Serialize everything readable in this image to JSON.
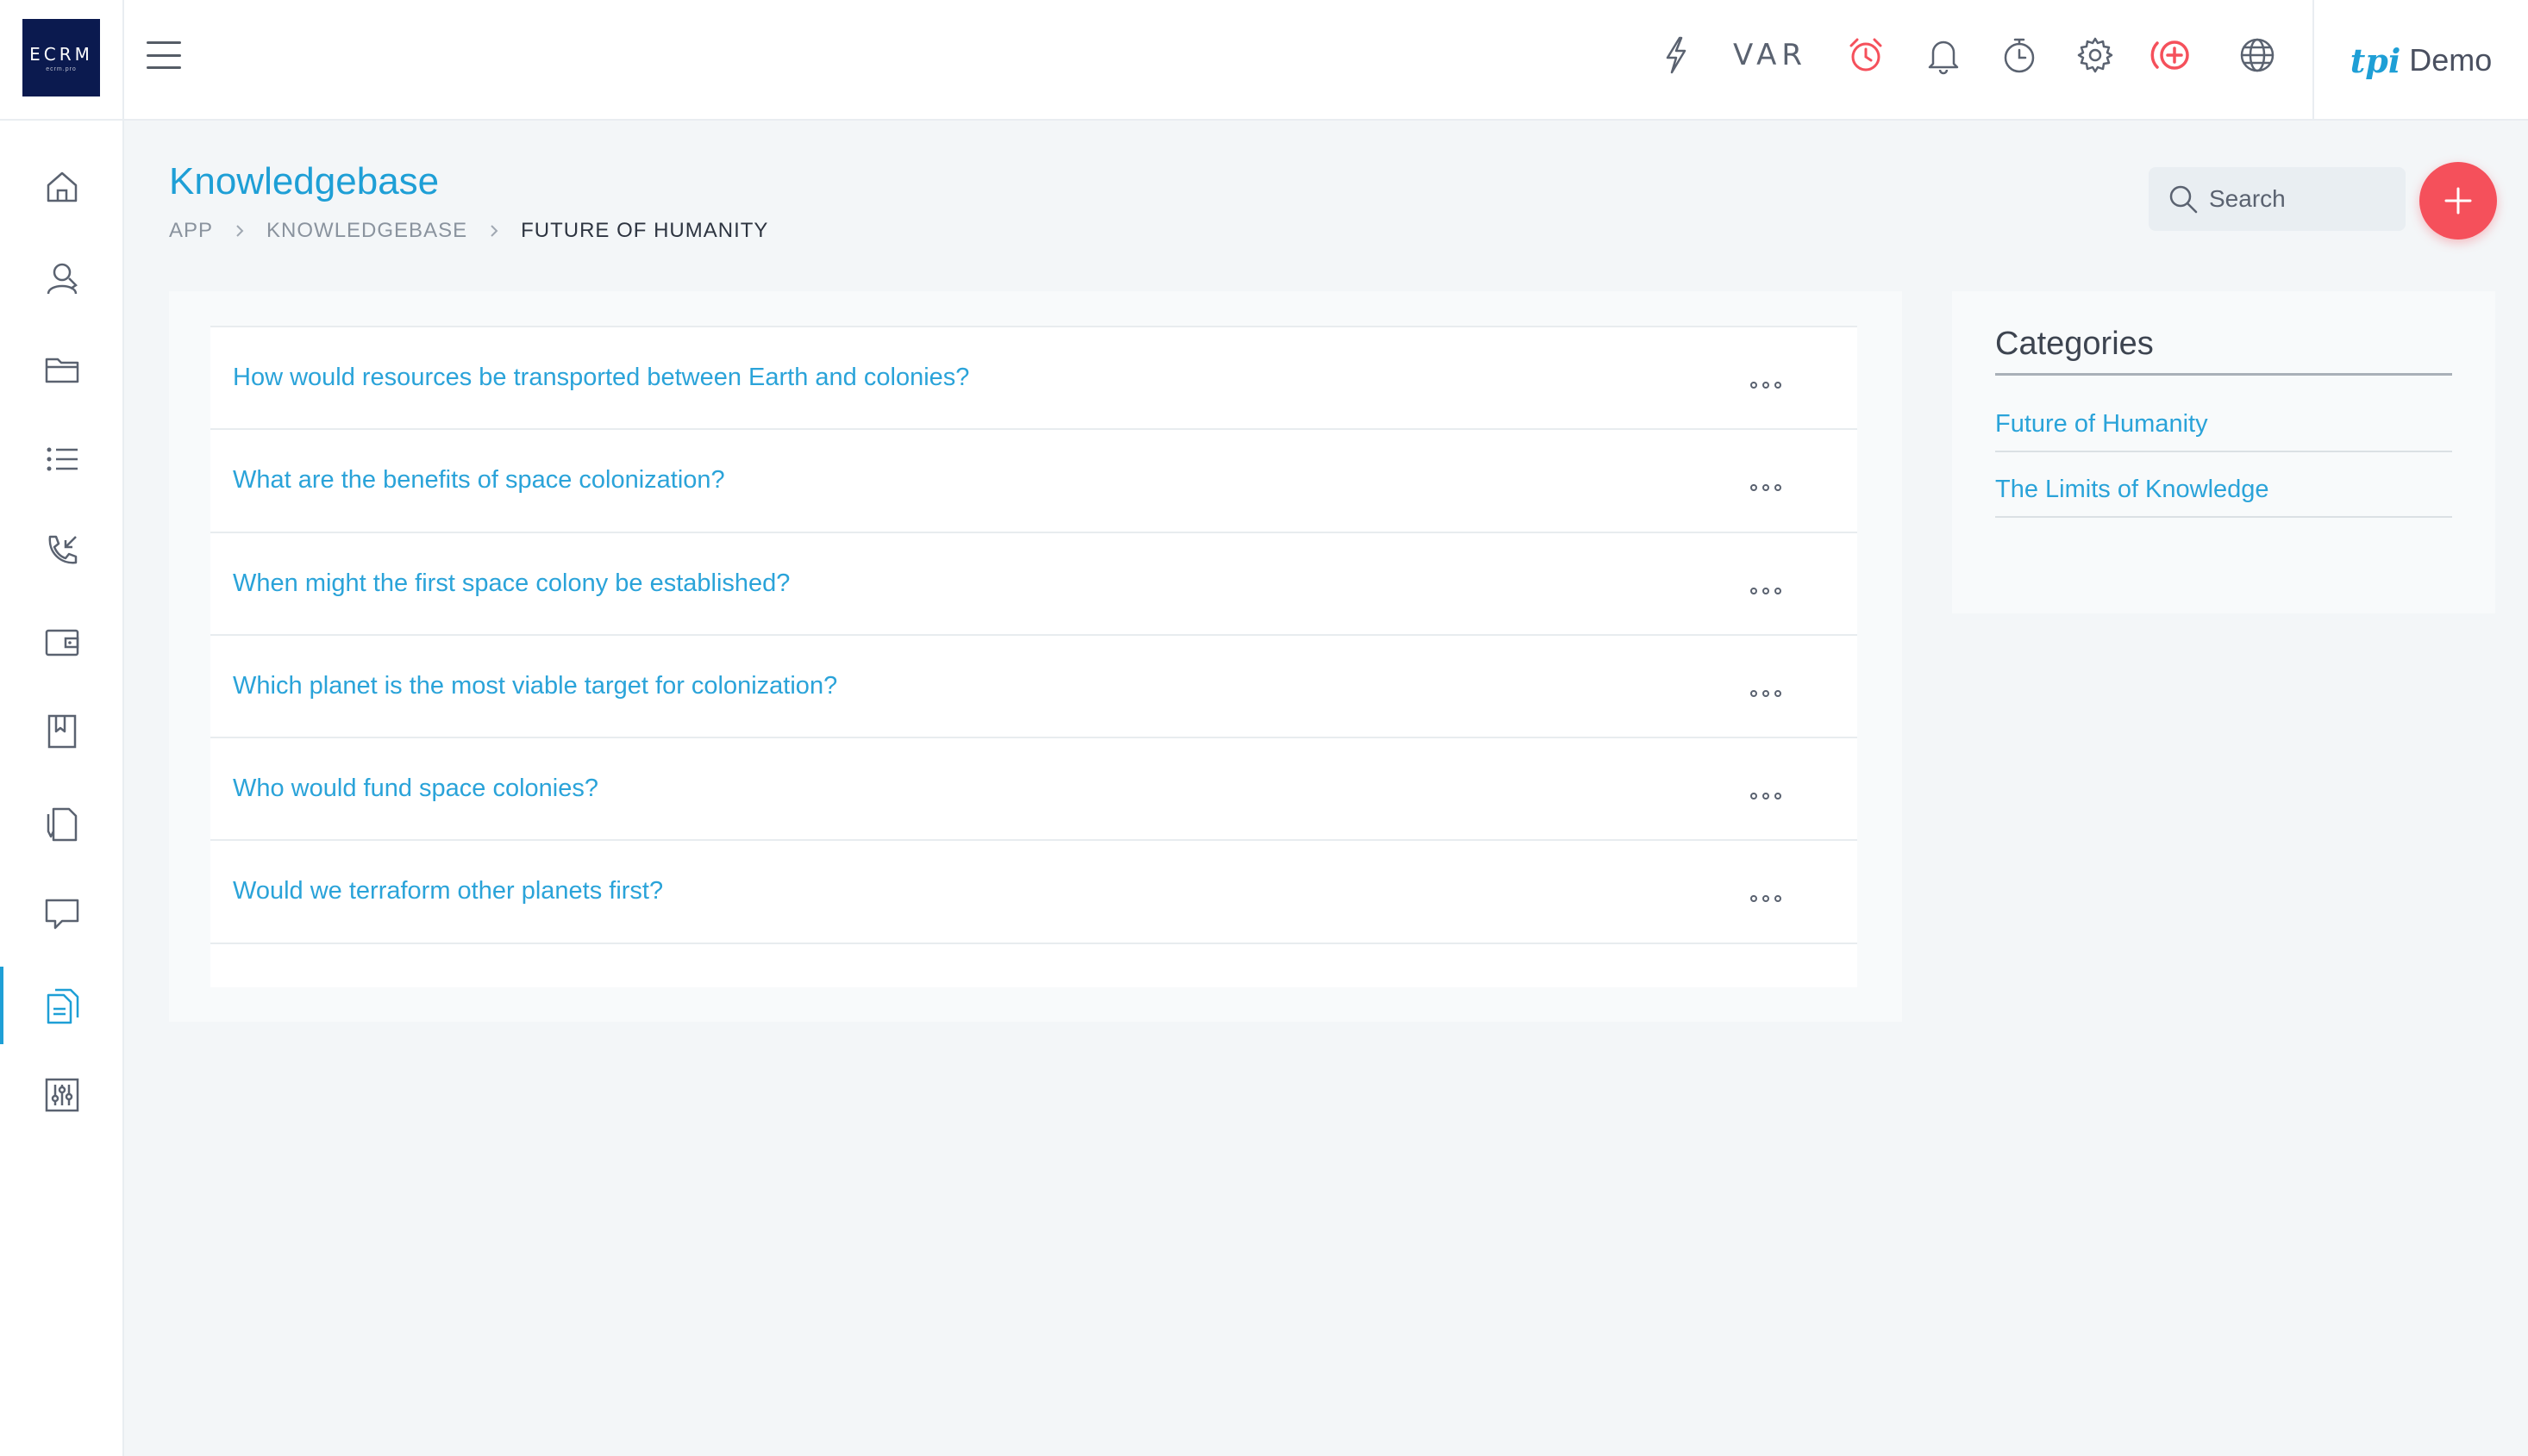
{
  "app": {
    "logo_text": "ECRM",
    "logo_subtext": "ecrm.pro"
  },
  "topbar": {
    "var_label": "VAR",
    "user": {
      "brand": "tpi",
      "name": "Demo"
    },
    "colors": {
      "alert": "#f5505b",
      "icon": "#5a6270",
      "accent": "#1e9fd6"
    }
  },
  "page": {
    "title": "Knowledgebase",
    "breadcrumb": [
      "APP",
      "KNOWLEDGEBASE",
      "FUTURE OF HUMANITY"
    ]
  },
  "search": {
    "placeholder": "Search"
  },
  "articles": [
    {
      "title": "How would resources be transported between Earth and colonies?"
    },
    {
      "title": "What are the benefits of space colonization?"
    },
    {
      "title": "When might the first space colony be established?"
    },
    {
      "title": "Which planet is the most viable target for colonization?"
    },
    {
      "title": "Who would fund space colonies?"
    },
    {
      "title": "Would we terraform other planets first?"
    }
  ],
  "categories": {
    "title": "Categories",
    "items": [
      "Future of Humanity",
      "The Limits of Knowledge"
    ]
  },
  "sidebar": {
    "items": [
      "home-icon",
      "contacts-icon",
      "folder-icon",
      "list-icon",
      "calls-icon",
      "wallet-icon",
      "bookmark-icon",
      "documents-icon",
      "chat-icon",
      "knowledgebase-icon",
      "settings-sliders-icon"
    ],
    "active_index": 9
  }
}
